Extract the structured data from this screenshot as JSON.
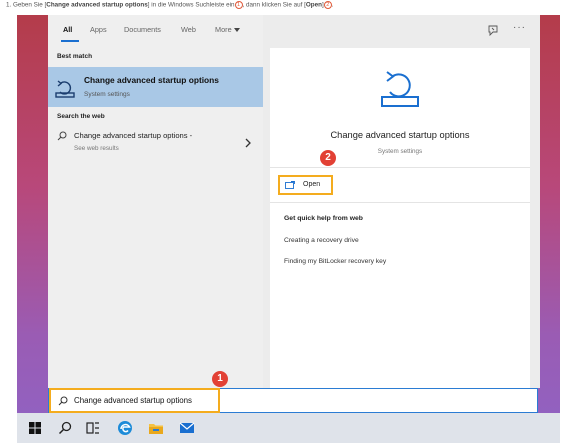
{
  "instruction": {
    "prefix": "1. Geben Sie [",
    "bold1": "Change advanced startup options",
    "middle1": "] in die Windows Suchleiste ein",
    "marker1": "1",
    "middle2": ", dann klicken Sie auf [",
    "bold2": "Open",
    "middle3": "]",
    "marker2": "2",
    "suffix": "."
  },
  "tabs": {
    "all": "All",
    "apps": "Apps",
    "documents": "Documents",
    "web": "Web",
    "more": "More",
    "more_glyph": "···"
  },
  "left_pane": {
    "best_match_label": "Best match",
    "best_match": {
      "title": "Change advanced startup options",
      "subtitle": "System settings"
    },
    "search_web_label": "Search the web",
    "web_item": {
      "title": "Change advanced startup options -",
      "subtitle": "See web results"
    }
  },
  "right_pane": {
    "title": "Change advanced startup options",
    "subtitle": "System settings",
    "open_label": "Open",
    "help_title": "Get quick help from web",
    "help_links": [
      "Creating a recovery drive",
      "Finding my BitLocker recovery key"
    ]
  },
  "search_box": {
    "value": "Change advanced startup options"
  },
  "badges": {
    "one": "1",
    "two": "2"
  },
  "colors": {
    "accent_blue": "#1a6fd0",
    "highlight_orange": "#f4ac1e",
    "badge_red": "#e24135",
    "selected_row": "#a9c8e6"
  },
  "taskbar": {
    "icons": [
      "windows-icon",
      "search-icon",
      "task-view-icon",
      "edge-icon",
      "file-explorer-icon",
      "mail-icon"
    ]
  }
}
